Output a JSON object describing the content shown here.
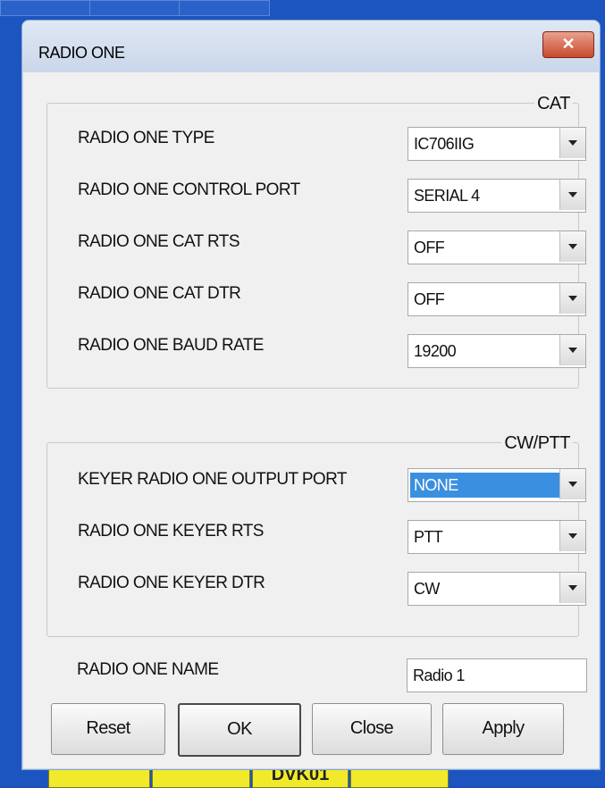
{
  "window": {
    "title": "RADIO ONE",
    "close_glyph": "✕"
  },
  "cat_group": {
    "legend": "CAT",
    "rows": [
      {
        "label": "RADIO ONE TYPE",
        "value": "IC706IIG"
      },
      {
        "label": "RADIO ONE CONTROL PORT",
        "value": "SERIAL 4"
      },
      {
        "label": "RADIO ONE CAT RTS",
        "value": "OFF"
      },
      {
        "label": "RADIO ONE CAT DTR",
        "value": "OFF"
      },
      {
        "label": "RADIO ONE BAUD RATE",
        "value": "19200"
      }
    ]
  },
  "cw_group": {
    "legend": "CW/PTT",
    "rows": [
      {
        "label": "KEYER RADIO ONE OUTPUT PORT",
        "value": "NONE"
      },
      {
        "label": "RADIO ONE KEYER RTS",
        "value": "PTT"
      },
      {
        "label": "RADIO ONE KEYER DTR",
        "value": "CW"
      }
    ]
  },
  "name_field": {
    "label": "RADIO ONE NAME",
    "value": "Radio 1"
  },
  "buttons": {
    "reset": "Reset",
    "ok": "OK",
    "close": "Close",
    "apply": "Apply"
  },
  "background_app": {
    "bottom_cell_text": "DVK01"
  },
  "colors": {
    "selection": "#3b8fe0",
    "close_button": "#c74a2c",
    "desktop": "#1a4fb3"
  }
}
